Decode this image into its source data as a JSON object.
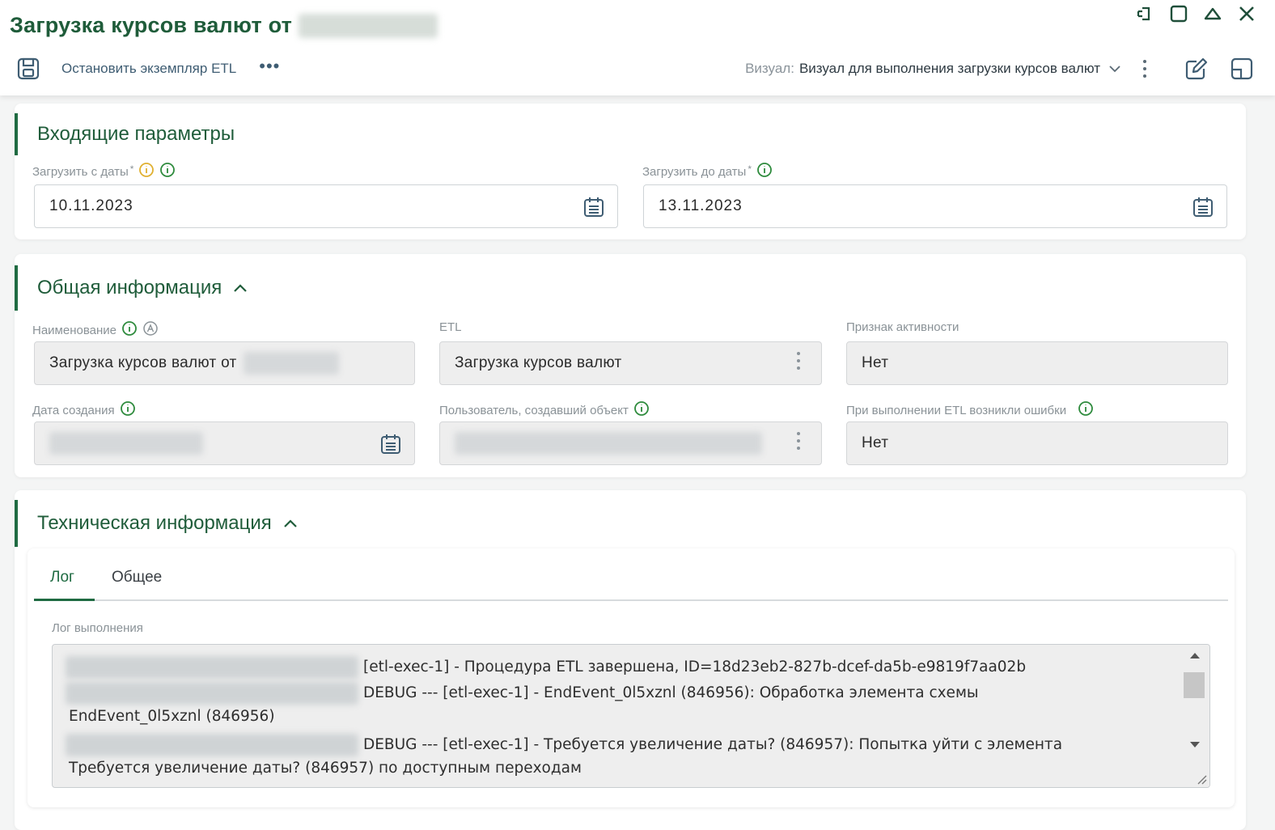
{
  "window": {
    "title": "Загрузка курсов валют от",
    "controls": [
      "pin-icon",
      "maximize-icon",
      "collapse-icon",
      "close-icon"
    ]
  },
  "toolbar": {
    "stop_label": "Остановить экземпляр ETL",
    "more_label": "•••",
    "visual_label": "Визуал:",
    "visual_value": "Визуал для выполнения загрузки курсов валют"
  },
  "input_params": {
    "header": "Входящие параметры",
    "from_label": "Загрузить с даты",
    "from_value": "10.11.2023",
    "to_label": "Загрузить до даты",
    "to_value": "13.11.2023",
    "required_mark": "*"
  },
  "general": {
    "header": "Общая информация",
    "name_label": "Наименование",
    "name_value": "Загрузка курсов валют от",
    "etl_label": "ETL",
    "etl_value": "Загрузка курсов валют",
    "active_label": "Признак активности",
    "active_value": "Нет",
    "created_label": "Дата создания",
    "creator_label": "Пользователь, создавший объект",
    "errors_label": "При выполнении ETL возникли ошибки",
    "errors_value": "Нет"
  },
  "technical": {
    "header": "Техническая информация",
    "tabs": [
      "Лог",
      "Общее"
    ],
    "log_label": "Лог выполнения",
    "log_lines": [
      "[etl-exec-1] - Процедура ETL завершена, ID=18d23eb2-827b-dcef-da5b-e9819f7aa02b",
      "DEBUG --- [etl-exec-1] - EndEvent_0l5xznl (846956): Обработка элемента схемы",
      "EndEvent_0l5xznl (846956)",
      "DEBUG --- [etl-exec-1] - Требуется увеличение даты? (846957): Попытка уйти с элемента",
      "Требуется увеличение даты? (846957) по доступным переходам"
    ]
  },
  "colors": {
    "accent": "#1f6b42",
    "title": "#1f5c3a",
    "info_green": "#2e8b3d",
    "info_yellow": "#e0b030"
  }
}
